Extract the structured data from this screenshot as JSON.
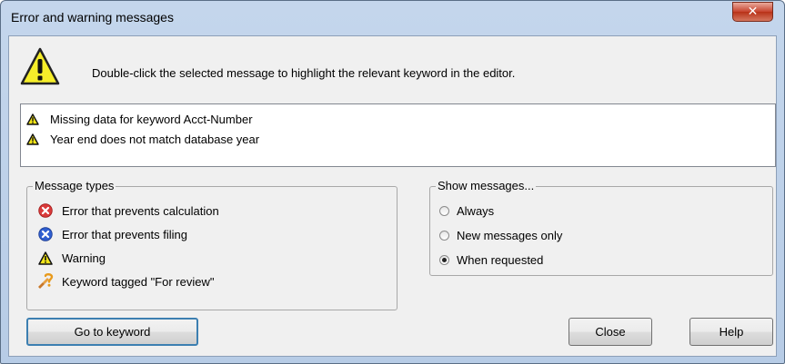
{
  "window": {
    "title": "Error and warning messages",
    "close_glyph": "✕"
  },
  "instruction": "Double-click the selected message to highlight the relevant keyword in the editor.",
  "messages": [
    {
      "icon": "warning-icon",
      "text": "Missing data for keyword Acct-Number"
    },
    {
      "icon": "warning-icon",
      "text": "Year end does not match database year"
    }
  ],
  "message_types": {
    "title": "Message types",
    "items": [
      {
        "icon": "calculation-error-icon",
        "label": "Error that prevents calculation",
        "color": "#d93a3a"
      },
      {
        "icon": "filing-error-icon",
        "label": "Error that prevents filing",
        "color": "#2f5fd0"
      },
      {
        "icon": "warning-icon",
        "label": "Warning",
        "color": "#f2e51a"
      },
      {
        "icon": "for-review-icon",
        "label": "Keyword tagged \"For review\"",
        "color": "#f0a030"
      }
    ]
  },
  "show_messages": {
    "title": "Show messages...",
    "options": [
      {
        "label": "Always",
        "selected": false
      },
      {
        "label": "New messages only",
        "selected": false
      },
      {
        "label": "When requested",
        "selected": true
      }
    ]
  },
  "buttons": {
    "go_to_keyword": "Go to keyword",
    "close": "Close",
    "help": "Help"
  }
}
